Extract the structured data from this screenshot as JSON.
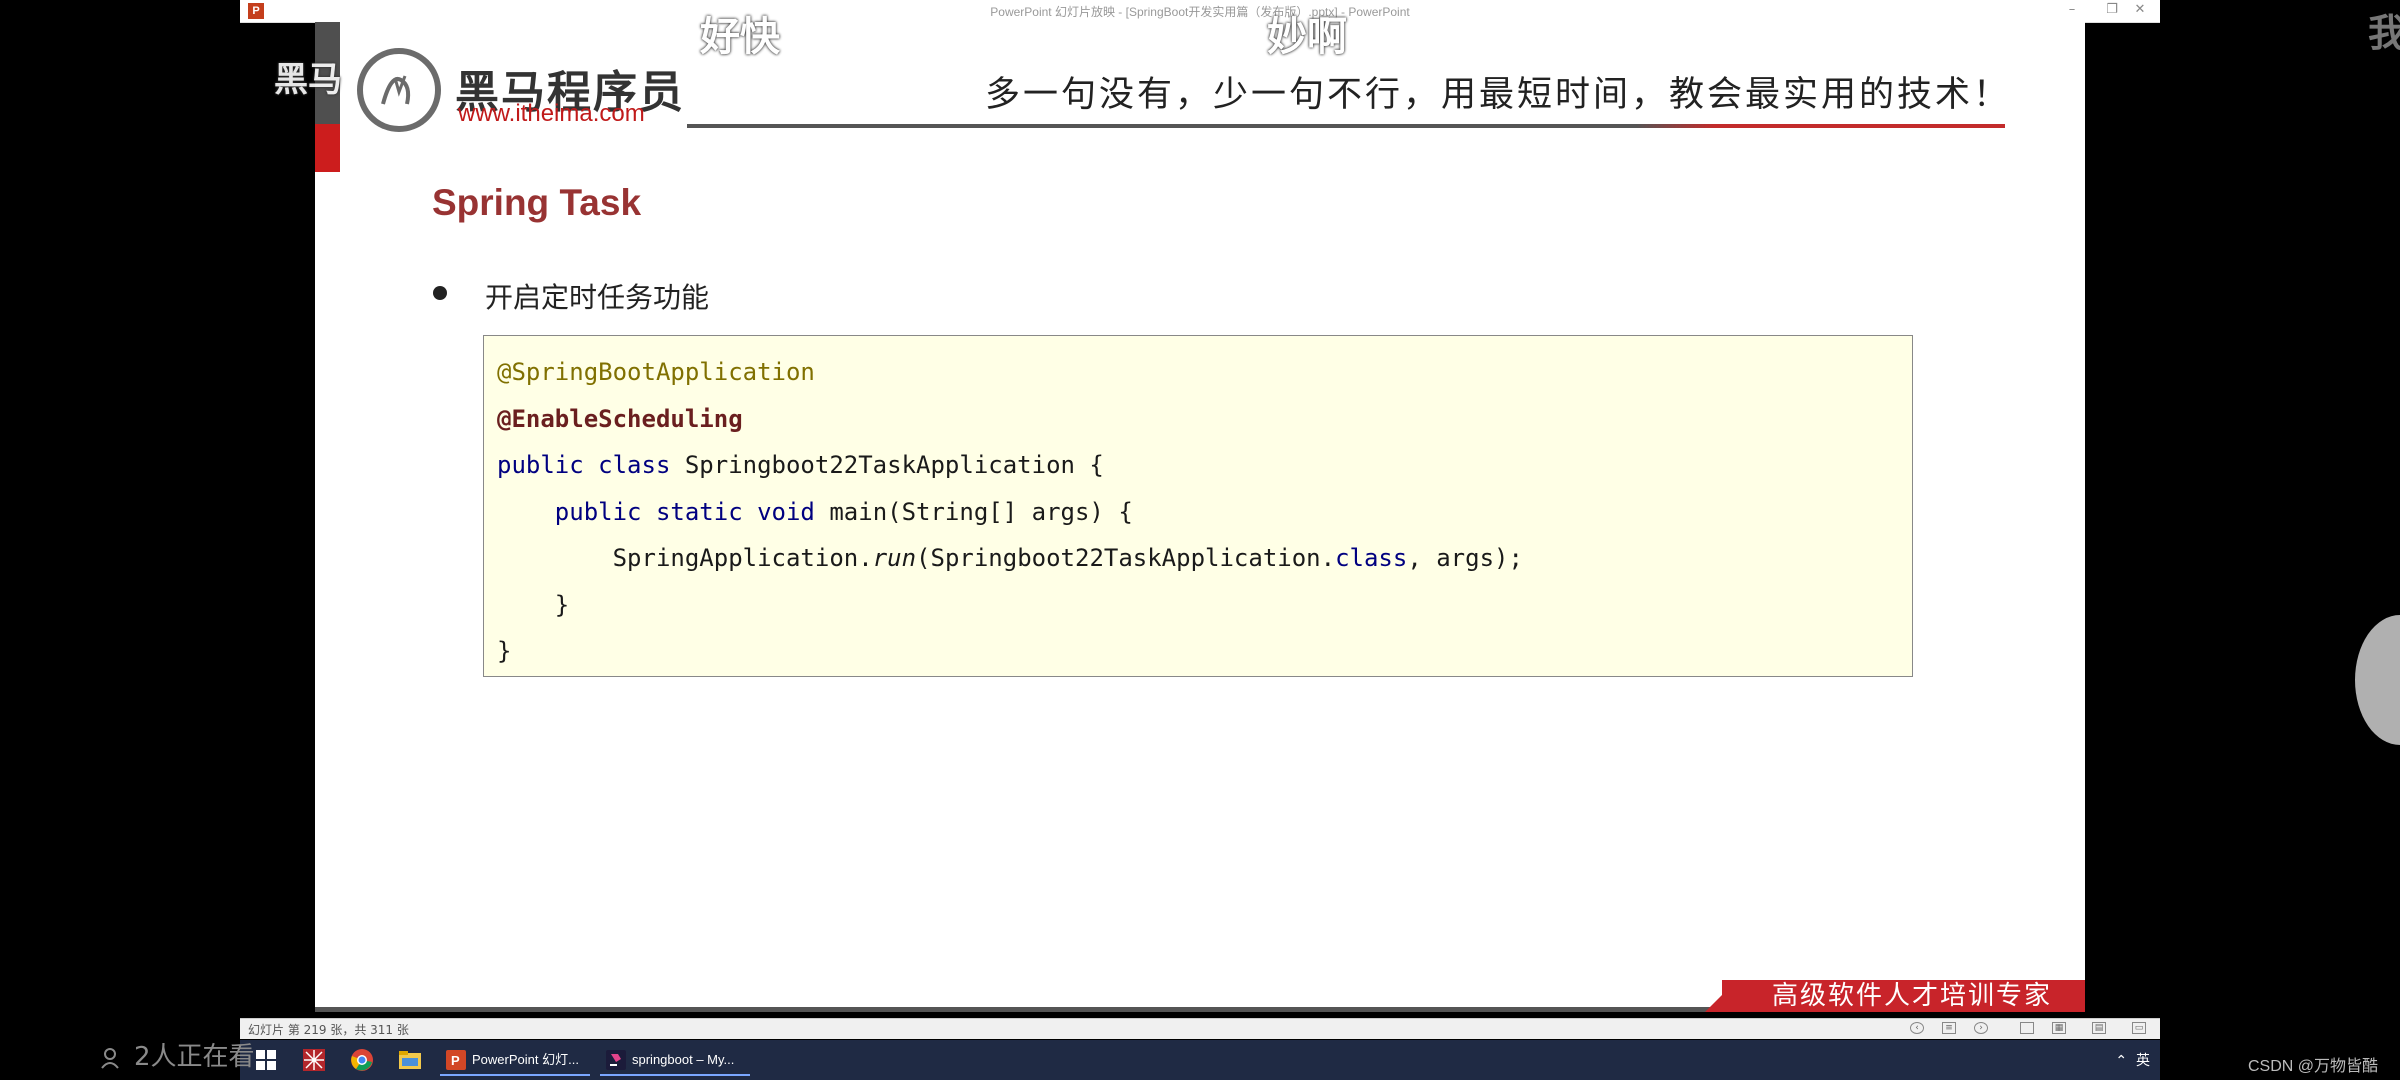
{
  "window": {
    "title": "PowerPoint 幻灯片放映 - [SpringBoot开发实用篇（发布版）.pptx] - PowerPoint",
    "app_icon_letter": "P",
    "controls": {
      "minimize": "–",
      "restore": "❐",
      "close": "✕"
    }
  },
  "slide": {
    "logo_name": "黑马程序员",
    "logo_url": "www.itheima.com",
    "slogan": "多一句没有，少一句不行，用最短时间，教会最实用的技术！",
    "title": "Spring Task",
    "bullet": "开启定时任务功能",
    "code": {
      "line1": "@SpringBootApplication",
      "line2": "@EnableScheduling",
      "line3_kw": "public class",
      "line3_rest": " Springboot22TaskApplication {",
      "line4_indent": "    ",
      "line4_kw": "public static void",
      "line4_rest": " main(String[] args) {",
      "line5_indent": "        ",
      "line5_a": "SpringApplication.",
      "line5_b": "run",
      "line5_c": "(Springboot22TaskApplication.",
      "line5_d": "class",
      "line5_e": ", args);",
      "line6": "    }",
      "line7": "}"
    },
    "footer": "高级软件人才培训专家"
  },
  "statusbar": {
    "pages": "幻灯片 第 219 张，共 311 张"
  },
  "taskbar": {
    "apps": [
      {
        "label": "PowerPoint 幻灯..."
      },
      {
        "label": "springboot – My..."
      }
    ],
    "tray": "英"
  },
  "overlay": {
    "danmaku1": "好快",
    "danmaku2": "妙啊",
    "danmaku3": "黑马",
    "viewers": "2人正在看",
    "csdn": "CSDN @万物皆酷",
    "right_char": "我"
  },
  "colors": {
    "brand_red": "#c8242a",
    "title_red": "#983333",
    "code_bg": "#ffffe6",
    "taskbar": "#1f2a44"
  }
}
